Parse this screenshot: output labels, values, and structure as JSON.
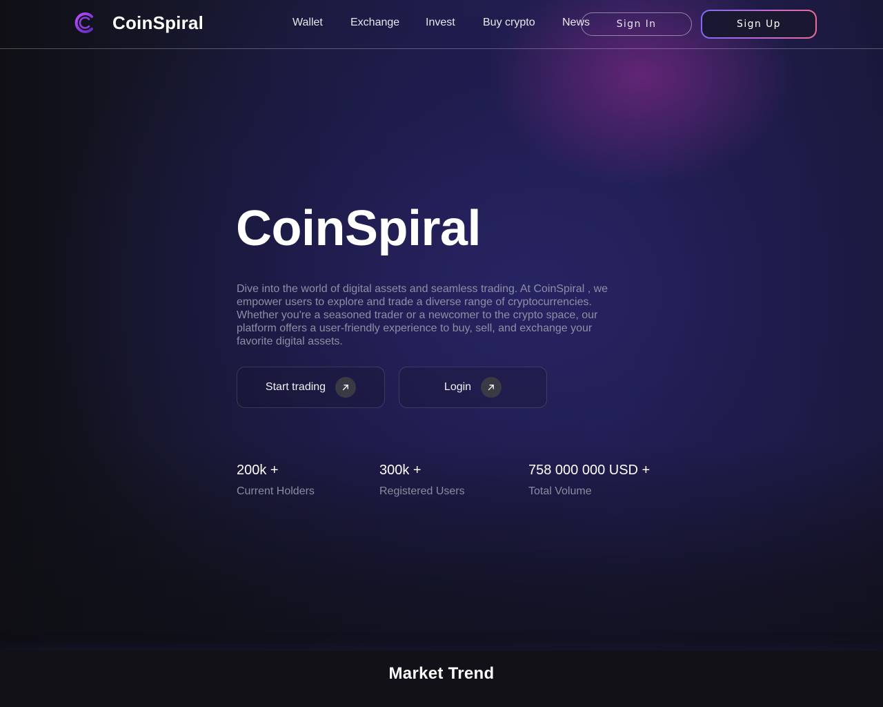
{
  "brand": {
    "name": "CoinSpiral",
    "logo_icon": "spiral-c-icon"
  },
  "nav": {
    "items": [
      {
        "label": "Wallet"
      },
      {
        "label": "Exchange"
      },
      {
        "label": "Invest"
      },
      {
        "label": "Buy crypto"
      },
      {
        "label": "News"
      }
    ],
    "sign_in": "Sign In",
    "sign_up": "Sign Up"
  },
  "hero": {
    "title": "CoinSpiral",
    "description": "Dive into the world of digital assets and seamless trading. At CoinSpiral , we empower users to explore and trade a diverse range of cryptocurrencies. Whether you're a seasoned trader or a newcomer to the crypto space, our platform offers a user-friendly experience to buy, sell, and exchange your favorite digital assets.",
    "buttons": [
      {
        "label": "Start trading",
        "icon": "arrow-up-right-icon"
      },
      {
        "label": "Login",
        "icon": "arrow-up-right-icon"
      }
    ]
  },
  "stats": [
    {
      "value": "200k +",
      "label": "Current Holders"
    },
    {
      "value": "300k +",
      "label": "Registered Users"
    },
    {
      "value": "758 000 000 USD +",
      "label": "Total Volume"
    }
  ],
  "market": {
    "title": "Market Trend"
  },
  "colors": {
    "accent_purple": "#7b6cf6",
    "accent_pink": "#f06a9a",
    "background": "#0e0e14"
  }
}
